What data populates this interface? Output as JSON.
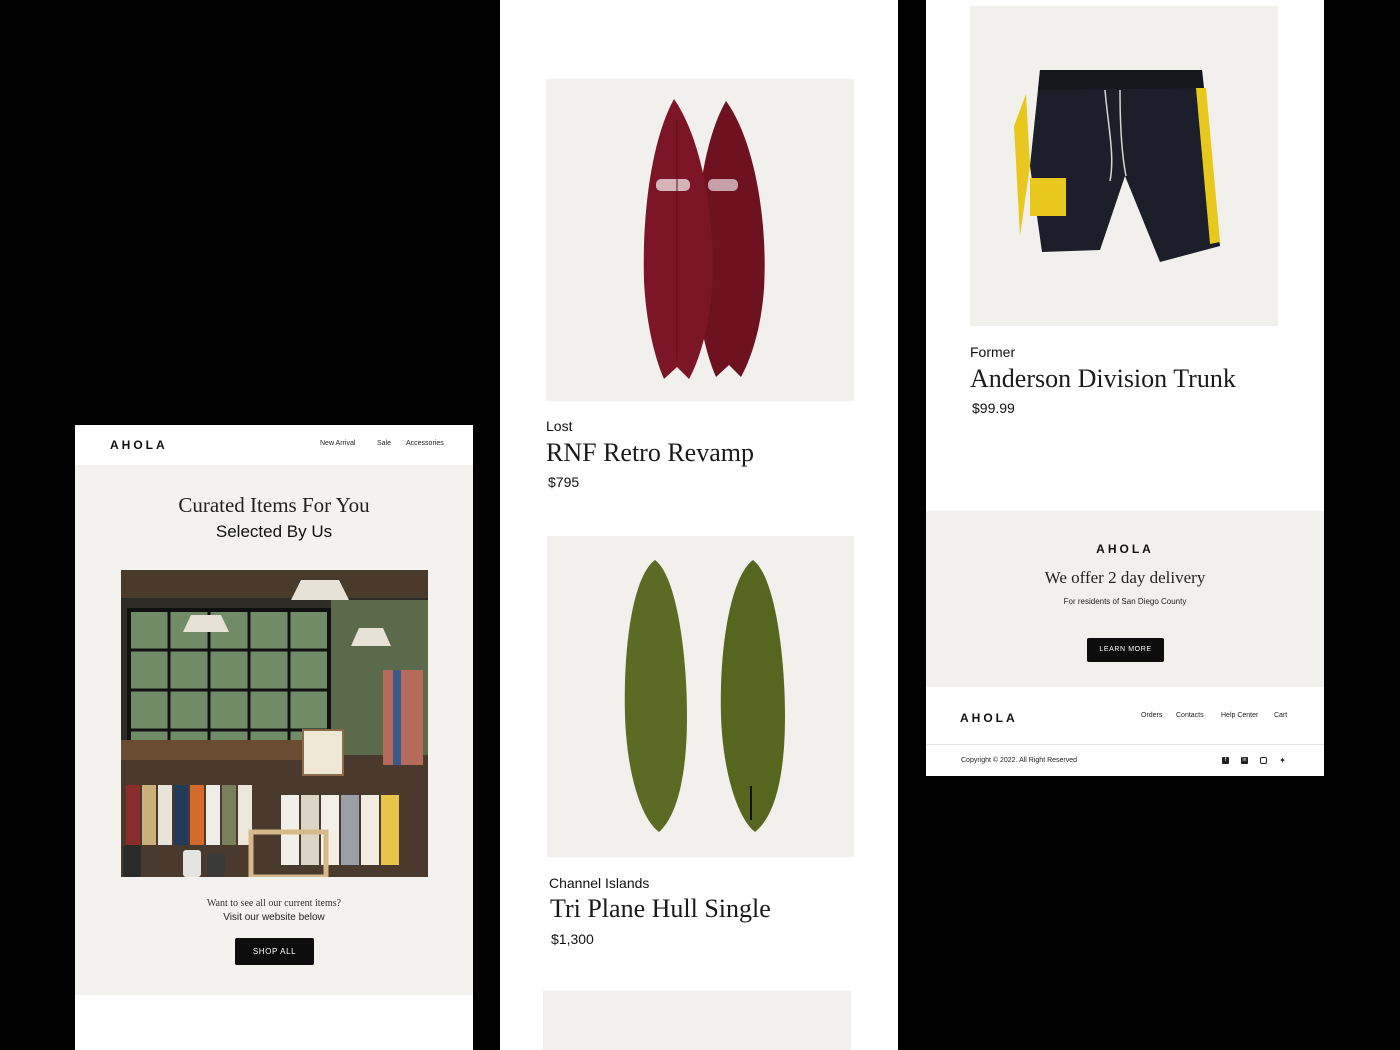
{
  "brand": {
    "logo": "AHOLA"
  },
  "email_left": {
    "nav": [
      {
        "label": "New Arrival"
      },
      {
        "label": "Sale"
      },
      {
        "label": "Accessories"
      }
    ],
    "hero_title_line1": "Curated Items For You",
    "hero_title_line2": "Selected By Us",
    "cta_line1": "Want to see all our current items?",
    "cta_line2": "Visit our website below",
    "shop_button": "SHOP ALL"
  },
  "products": [
    {
      "brand": "Lost",
      "name": "RNF Retro Revamp",
      "price": "$795",
      "color": "#7a1424"
    },
    {
      "brand": "Channel Islands",
      "name": "Tri Plane Hull Single",
      "price": "$1,300",
      "color": "#5b6b25"
    },
    {
      "brand": "Former",
      "name": "Anderson Division Trunk",
      "price": "$99.99",
      "color": "#1c1f2a"
    }
  ],
  "promo": {
    "logo": "AHOLA",
    "headline": "We offer 2 day delivery",
    "subtext": "For residents of San Diego County",
    "button": "LEARN MORE"
  },
  "footer": {
    "logo": "AHOLA",
    "links": [
      {
        "label": "Orders"
      },
      {
        "label": "Contacts"
      },
      {
        "label": "Help Center"
      },
      {
        "label": "Cart"
      }
    ],
    "copyright": "Copyright © 2022. All Right Reserved",
    "social_icons": [
      "facebook-icon",
      "linkedin-icon",
      "instagram-icon",
      "twitter-icon"
    ]
  },
  "colors": {
    "background": "#000000",
    "panel": "#ffffff",
    "tile": "#f1f0ec",
    "button": "#0d0d0d",
    "accent_yellow": "#e9c81e"
  }
}
